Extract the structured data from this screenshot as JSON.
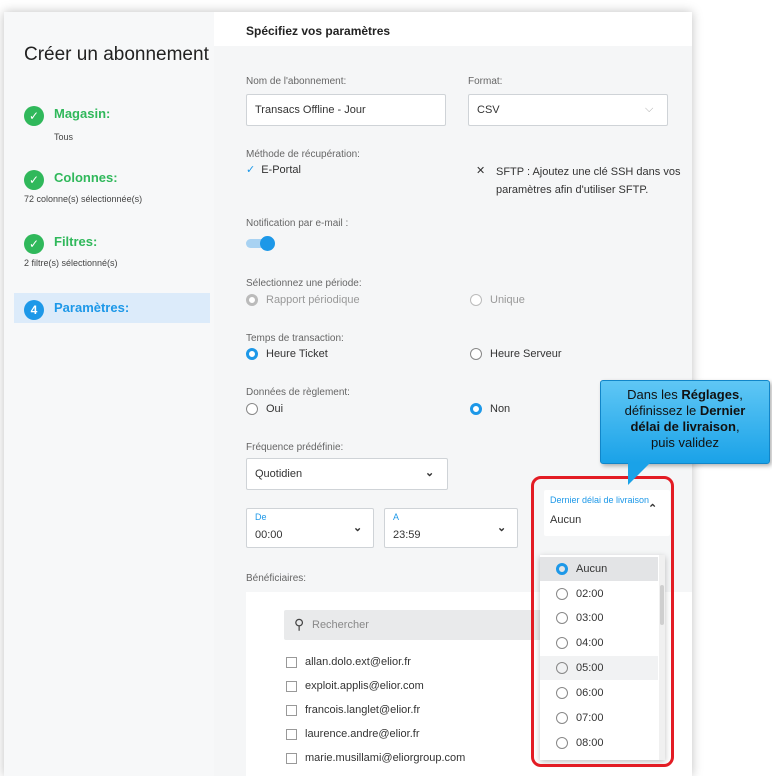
{
  "sidebar": {
    "title": "Créer un abonnement",
    "steps": [
      {
        "label": "Magasin:",
        "sub": "Tous"
      },
      {
        "label": "Colonnes:",
        "sub": "72 colonne(s) sélectionnée(s)"
      },
      {
        "label": "Filtres:",
        "sub": "2 filtre(s) sélectionné(s)"
      },
      {
        "number": "4",
        "label": "Paramètres:"
      }
    ]
  },
  "main": {
    "title": "Spécifiez vos paramètres",
    "subscription_name": {
      "label": "Nom de l'abonnement:",
      "value": "Transacs Offline - Jour"
    },
    "format": {
      "label": "Format:",
      "value": "CSV"
    },
    "retrieval": {
      "label": "Méthode de récupération:",
      "eportal": "E-Portal",
      "sftp": "SFTP : Ajoutez une clé SSH dans vos paramètres afin d'utiliser SFTP."
    },
    "notification": {
      "label": "Notification par e-mail :",
      "enabled": true
    },
    "period": {
      "label": "Sélectionnez une période:",
      "option1": "Rapport périodique",
      "option2": "Unique"
    },
    "transaction_time": {
      "label": "Temps de transaction:",
      "option1": "Heure Ticket",
      "option2": "Heure Serveur"
    },
    "settlement": {
      "label": "Données de règlement:",
      "option1": "Oui",
      "option2": "Non"
    },
    "frequency": {
      "label": "Fréquence prédéfinie:",
      "value": "Quotidien"
    },
    "from": {
      "label": "De",
      "value": "00:00"
    },
    "to": {
      "label": "A",
      "value": "23:59"
    },
    "delivery": {
      "label": "Dernier délai de livraison",
      "value": "Aucun"
    },
    "recipients": {
      "label": "Bénéficiaires:",
      "search_placeholder": "Rechercher",
      "emails": [
        "allan.dolo.ext@elior.fr",
        "exploit.applis@elior.com",
        "francois.langlet@elior.fr",
        "laurence.andre@elior.fr",
        "marie.musillami@eliorgroup.com"
      ]
    }
  },
  "dropdown": {
    "options": [
      "Aucun",
      "02:00",
      "03:00",
      "04:00",
      "05:00",
      "06:00",
      "07:00",
      "08:00"
    ],
    "selected": "Aucun"
  },
  "callout": {
    "t1": "Dans les ",
    "b1": "Réglages",
    "t2": ",",
    "t3": "définissez le ",
    "b2": "Dernier",
    "b3": "délai de livraison",
    "t4": ",",
    "t5": "puis validez"
  },
  "colors": {
    "accent": "#1d98e8",
    "success": "#30b85b",
    "highlight": "#e31c24"
  }
}
